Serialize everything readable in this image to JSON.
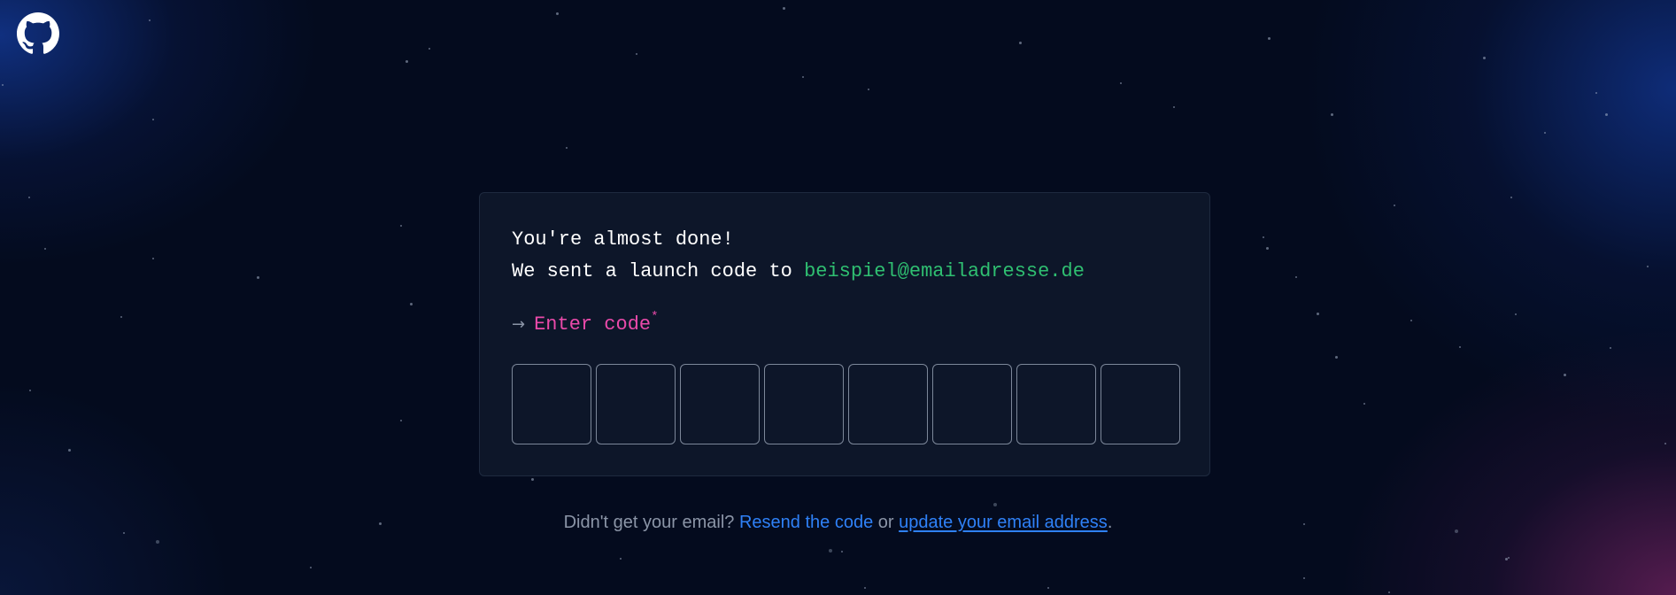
{
  "header": {
    "logo_icon": "github-octocat-icon"
  },
  "card": {
    "line1": "You're almost done!",
    "line2_prefix": "We sent a launch code to ",
    "email": "beispiel@emailadresse.de",
    "prompt_arrow": "→",
    "prompt_label": "Enter code",
    "required_marker": "*",
    "code_box_count": 8
  },
  "footer": {
    "question": "Didn't get your email? ",
    "resend_link": "Resend the code",
    "or": " or ",
    "update_link": "update your email address",
    "period": "."
  },
  "colors": {
    "background": "#040b1e",
    "card": "#0d1629",
    "email": "#2fbf71",
    "prompt": "#ea4aaa",
    "link": "#2f81f7",
    "muted_text": "#8b95a7"
  }
}
